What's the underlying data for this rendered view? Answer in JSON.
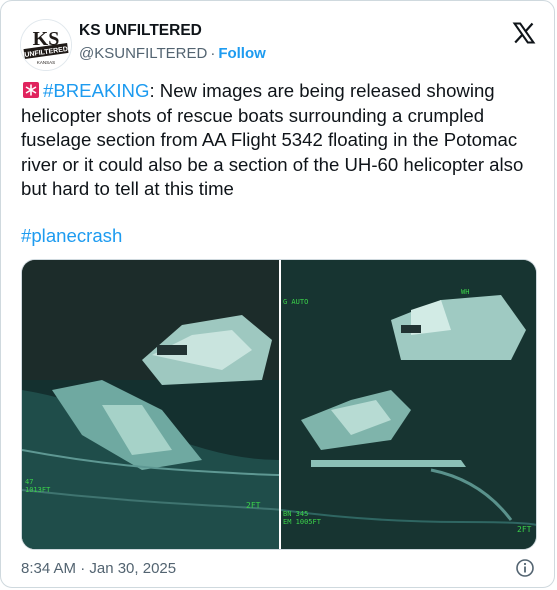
{
  "author": {
    "name": "KS UNFILTERED",
    "handle": "@KSUNFILTERED",
    "follow_label": "Follow",
    "avatar_text_top": "KS",
    "avatar_text_mid": "UNFILTERED",
    "avatar_text_bottom": "KANSAS"
  },
  "tweet": {
    "hashtag_breaking": "#BREAKING",
    "body": ": New images are being released showing helicopter shots of rescue boats surrounding a crumpled fuselage section from AA Flight 5342 floating in the Potomac river or it could also be a section of the UH-60 helicopter also but hard to tell at this time",
    "hashtag_planecrash": "#planecrash"
  },
  "media": {
    "left_hud_left_a": "47",
    "left_hud_left_b": "1013FT",
    "left_hud_right": "2FT",
    "right_hud_top_left": "G AUTO",
    "right_hud_top_right": "WH",
    "right_hud_bottom_a": "BN 345",
    "right_hud_bottom_b": "EM 1005FT",
    "right_hud_right": "2FT"
  },
  "meta": {
    "timestamp": "8:34 AM · Jan 30, 2025"
  },
  "colors": {
    "link": "#1d9bf0",
    "text": "#0f1419",
    "secondary": "#536471",
    "hud": "#3bd24a"
  }
}
